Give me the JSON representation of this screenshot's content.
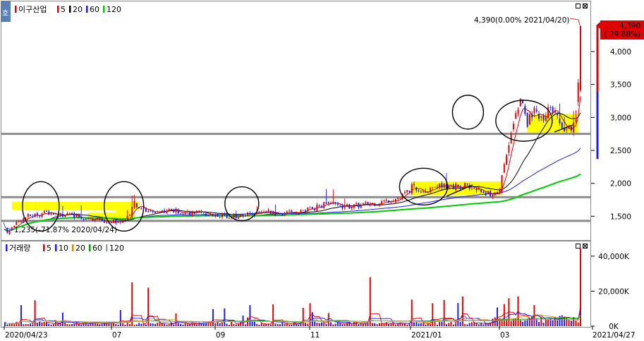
{
  "colors": {
    "up": "#e00000",
    "down": "#1c1cf0",
    "ma5": "#e00000",
    "ma20": "#000000",
    "ma60": "#1c1cf0",
    "ma120": "#00cc00",
    "vol_ma5": "#e00000",
    "vol_ma10": "#1c1cf0",
    "vol_ma20": "#d09000",
    "vol_ma60": "#00a000",
    "vol_ma120": "#a0a0a0",
    "zone": "#ffff00",
    "hline": "#8c8c8c",
    "price_badge": "#e00000"
  },
  "header_icon": "호",
  "price_legend": {
    "title": "이구산업",
    "ma": [
      "5",
      "20",
      "60",
      "120"
    ]
  },
  "volume_legend": {
    "title": "거래량",
    "ma": [
      "5",
      "10",
      "20",
      "60",
      "120"
    ]
  },
  "max_label": "4,390(0.00% 2021/04/20)",
  "min_label": "1,235(-71.87% 2020/04/24)",
  "current_price": "4,390",
  "current_change": "( 29.88%)",
  "chart_data": [
    {
      "type": "candlestick",
      "title": "이구산업",
      "yticks": [
        1500,
        2000,
        2500,
        3000,
        3500,
        4000
      ],
      "ytick_labels": [
        "1,500",
        "2,000",
        "2,500",
        "3,000",
        "3,500",
        "4,000"
      ],
      "ylim": [
        1150,
        4750
      ],
      "date_range": [
        "2020/04/23",
        "2021/04/27"
      ],
      "x_labels": [
        "2020/04/23",
        "07",
        "09",
        "11",
        "2021/01",
        "03",
        "2021/04/27"
      ],
      "horizontal_lines": [
        1430,
        1790,
        2750
      ],
      "max_point": {
        "value": 4390,
        "date": "2021/04/20"
      },
      "min_point": {
        "value": 1235,
        "date": "2020/04/24"
      },
      "moving_averages": [
        "5",
        "20",
        "60",
        "120"
      ]
    },
    {
      "type": "bar",
      "title": "거래량",
      "yticks": [
        0,
        20000,
        40000
      ],
      "ytick_labels": [
        "0K",
        "20,000K",
        "40,000K"
      ],
      "ylim": [
        0,
        48000
      ],
      "moving_averages": [
        "5",
        "10",
        "20",
        "60",
        "120"
      ]
    }
  ]
}
